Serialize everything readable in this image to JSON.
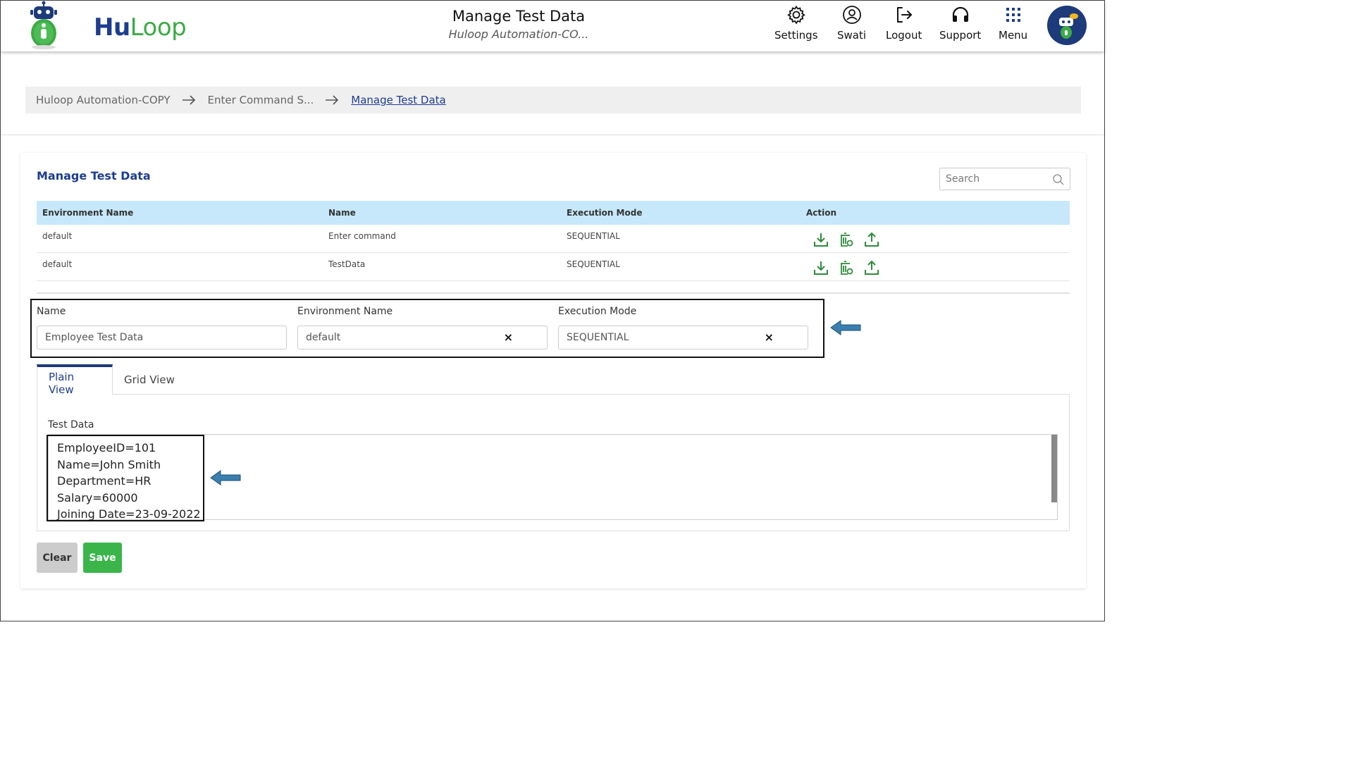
{
  "header": {
    "brand_hu": "Hu",
    "brand_loop": "Loop",
    "title": "Manage Test Data",
    "subtitle": "Huloop Automation-CO...",
    "nav": {
      "settings": "Settings",
      "user": "Swati",
      "logout": "Logout",
      "support": "Support",
      "menu": "Menu"
    }
  },
  "breadcrumb": {
    "items": [
      "Huloop Automation-COPY",
      "Enter Command S...",
      "Manage Test Data"
    ]
  },
  "card": {
    "title": "Manage Test Data",
    "search_placeholder": "Search"
  },
  "table": {
    "columns": [
      "Environment Name",
      "Name",
      "Execution Mode",
      "Action"
    ],
    "rows": [
      {
        "environment": "default",
        "name": "Enter command",
        "mode": "SEQUENTIAL",
        "actions": [
          "download-icon",
          "delete-icon",
          "upload-icon"
        ]
      },
      {
        "environment": "default",
        "name": "TestData",
        "mode": "SEQUENTIAL",
        "actions": [
          "download-icon",
          "delete-icon",
          "upload-icon"
        ]
      }
    ]
  },
  "form": {
    "name_label": "Name",
    "name_value": "Employee Test Data",
    "env_label": "Environment Name",
    "env_value": "default",
    "mode_label": "Execution Mode",
    "mode_value": "SEQUENTIAL",
    "clear_glyph": "×"
  },
  "tabs": [
    "Plain View",
    "Grid View"
  ],
  "test_data": {
    "label": "Test Data",
    "lines": [
      "EmployeeID=101",
      "Name=John Smith",
      "Department=HR",
      "Salary=60000",
      "Joining Date=23-09-2022"
    ]
  },
  "buttons": {
    "clear": "Clear",
    "save": "Save"
  },
  "colors": {
    "brand_blue": "#1d3d8f",
    "brand_green": "#3daa45",
    "table_header": "#c6e8fa",
    "save_green": "#3bb54a",
    "action_green": "#2e8b3a",
    "callout_arrow": "#3a7fae"
  }
}
